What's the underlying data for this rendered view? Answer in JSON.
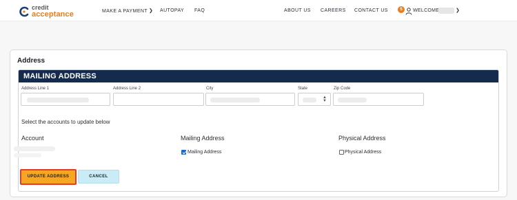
{
  "header": {
    "logo_line1": "credit",
    "logo_line2": "acceptance",
    "nav_left": [
      "MAKE A PAYMENT",
      "AUTOPAY",
      "FAQ"
    ],
    "nav_right": [
      "ABOUT US",
      "CAREERS",
      "CONTACT US"
    ],
    "notification_count": "5",
    "welcome_label": "WELCOME,"
  },
  "card": {
    "title": "Address",
    "panel_title": "MAILING ADDRESS",
    "fields": {
      "address1_label": "Address Line 1",
      "address2_label": "Address Line 2",
      "city_label": "City",
      "state_label": "State",
      "zip_label": "Zip Code",
      "address2_value": ""
    },
    "select_accounts_text": "Select the accounts to update below",
    "columns": [
      "Account",
      "Mailing Address",
      "Physical Address"
    ],
    "mailing_checkbox_label": "Mailing Address",
    "mailing_checked": true,
    "physical_checkbox_label": "Physical Address",
    "physical_checked": false,
    "update_button": "UPDATE ADDRESS",
    "cancel_button": "CANCEL"
  },
  "colors": {
    "brand_orange": "#f07a1a",
    "panel_header": "#142b4e",
    "update_button_bg": "#f5a623",
    "update_button_highlight": "#e23a2e",
    "cancel_button_bg": "#c9ecf6"
  }
}
